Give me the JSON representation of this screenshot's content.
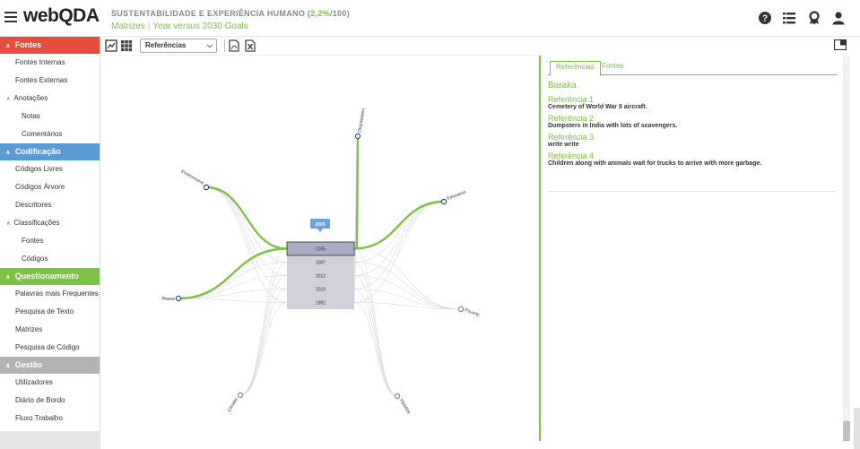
{
  "header": {
    "logo": {
      "web": "web",
      "qda": "QDA"
    },
    "project_title": "SUSTENTABILIDADE E EXPERIÊNCIA HUMANO",
    "project_pct": "2,2%",
    "project_total": "/100)",
    "project_open": " (",
    "breadcrumb": [
      "Matrizes",
      "Year versus 2030 Goals"
    ],
    "icons": [
      "help-icon",
      "list-icon",
      "award-icon",
      "user-icon"
    ]
  },
  "sidebar": {
    "sections": [
      {
        "title": "Fontes",
        "color": "#e74c3c",
        "items": [
          {
            "label": "Fontes Internas"
          },
          {
            "label": "Fontes Externas"
          },
          {
            "label": "Anotações",
            "expandable": true
          },
          {
            "label": "Notas",
            "sub": true
          },
          {
            "label": "Comentários",
            "sub": true
          }
        ]
      },
      {
        "title": "Codificação",
        "color": "#5b9bd5",
        "items": [
          {
            "label": "Códigos Livres"
          },
          {
            "label": "Códigos Árvore"
          },
          {
            "label": "Descritores"
          },
          {
            "label": "Classificações",
            "expandable": true
          },
          {
            "label": "Fontes",
            "sub": true
          },
          {
            "label": "Códigos",
            "sub": true
          }
        ]
      },
      {
        "title": "Questionamento",
        "color": "#7dc242",
        "items": [
          {
            "label": "Palavras mais Frequentes"
          },
          {
            "label": "Pesquisa de Texto"
          },
          {
            "label": "Matrizes"
          },
          {
            "label": "Pesquisa de Código"
          }
        ]
      },
      {
        "title": "Gestão",
        "color": "#b3b3b3",
        "items": [
          {
            "label": "Utilizadores"
          },
          {
            "label": "Diário de Bordo"
          },
          {
            "label": "Fluxo Trabalho"
          }
        ]
      }
    ]
  },
  "toolbar": {
    "select_value": "Referências",
    "icons": [
      "chart-export-icon",
      "grid-icon",
      "pdf-icon",
      "excel-icon"
    ]
  },
  "right_panel": {
    "tabs": [
      "Referências",
      "Fontes"
    ],
    "active_tab": "Referências",
    "source_name": "Baraka",
    "references": [
      {
        "title": "Referência 1",
        "text": "Cemetery of World War II aircraft."
      },
      {
        "title": "Referência 2",
        "text": "Dumpsters in India with lots of scavengers."
      },
      {
        "title": "Referência 3",
        "text": "write write"
      },
      {
        "title": "Referência 4",
        "text": "Children along with animals wait for trucks to arrive with more garbage."
      }
    ]
  },
  "diagram": {
    "tooltip": "2005",
    "years": [
      "2005",
      "2007",
      "2012",
      "2019",
      "1992"
    ],
    "selected_year": "2005",
    "goals": [
      "Degradation",
      "Environment",
      "Education",
      "Peace",
      "Poverty",
      "Climate",
      "Injustice"
    ],
    "highlighted_goals": [
      "Degradation",
      "Environment",
      "Education",
      "Peace"
    ],
    "colors": {
      "accent": "#7dc242",
      "node": "#1a4f8a",
      "faint_node": "#5b8fd0",
      "box": "#d1d1dc",
      "box_selected": "#a9acc3"
    }
  }
}
